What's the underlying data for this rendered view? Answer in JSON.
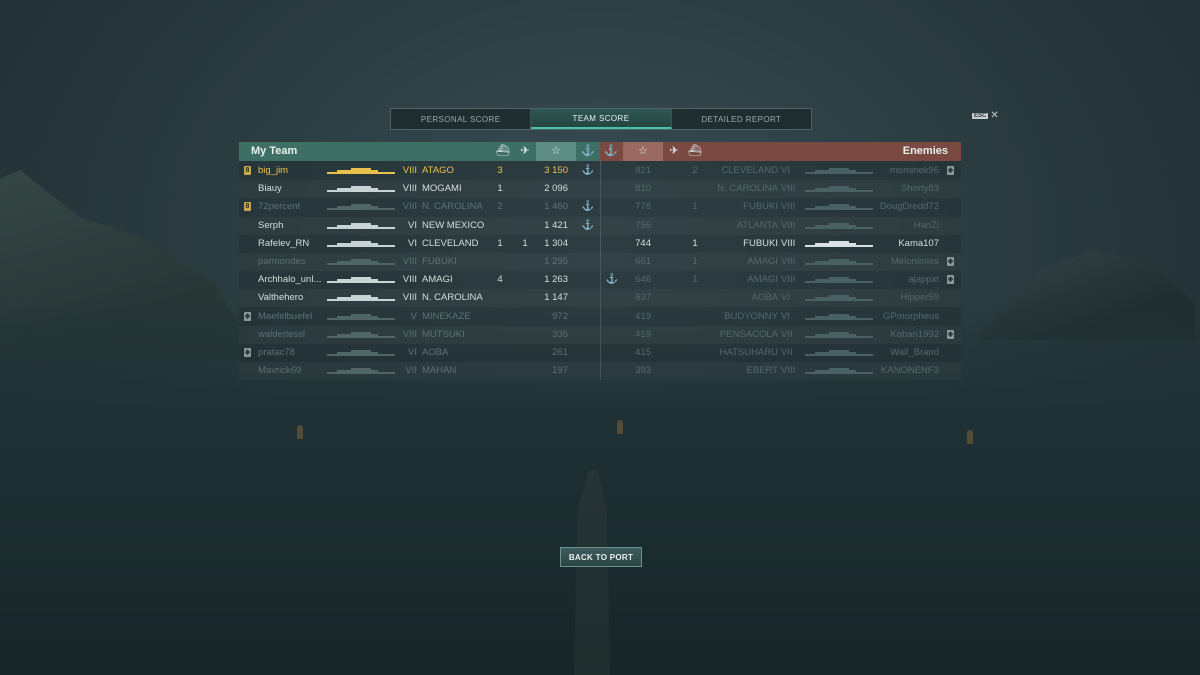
{
  "tabs": [
    {
      "label": "PERSONAL SCORE",
      "active": false
    },
    {
      "label": "TEAM SCORE",
      "active": true
    },
    {
      "label": "DETAILED REPORT",
      "active": false
    }
  ],
  "esc": {
    "key": "ESC",
    "close": "✕"
  },
  "team_header": {
    "title": "My Team",
    "icons": [
      "ship-icon",
      "planes-icon",
      "star-icon",
      "anchor-icon"
    ]
  },
  "enemy_header": {
    "title": "Enemies",
    "icons": [
      "anchor-icon",
      "star-icon",
      "planes-icon",
      "ship-icon"
    ]
  },
  "icon_glyphs": {
    "star": "☆",
    "anchor": "⚓",
    "planes": "✈",
    "ship": "⛴",
    "rank_badge": "8",
    "shield": "◈"
  },
  "colors": {
    "team_header": "#3d6f65",
    "enemy_header": "#7a4a42",
    "player_highlight": "#e8c14d",
    "active_tab_accent": "#47c2ad"
  },
  "my_team": [
    {
      "player": "big_jim",
      "tier": "VIII",
      "ship": "ATAGO",
      "kills": "3",
      "planes": "",
      "score": "3 150",
      "anchor": true,
      "badge": "rank",
      "state": "me"
    },
    {
      "player": "Biauy",
      "tier": "VIII",
      "ship": "MOGAMI",
      "kills": "1",
      "planes": "",
      "score": "2 096",
      "anchor": false,
      "badge": "",
      "state": "alive"
    },
    {
      "player": "72percent",
      "tier": "VIII",
      "ship": "N. CAROLINA",
      "kills": "2",
      "planes": "",
      "score": "1 460",
      "anchor": true,
      "badge": "rank",
      "state": "dead"
    },
    {
      "player": "Serph",
      "tier": "VI",
      "ship": "NEW MEXICO",
      "kills": "",
      "planes": "",
      "score": "1 421",
      "anchor": true,
      "badge": "",
      "state": "alive"
    },
    {
      "player": "Rafelev_RN",
      "tier": "VI",
      "ship": "CLEVELAND",
      "kills": "1",
      "planes": "1",
      "score": "1 304",
      "anchor": false,
      "badge": "",
      "state": "alive"
    },
    {
      "player": "parmondes",
      "tier": "VIII",
      "ship": "FUBUKI",
      "kills": "",
      "planes": "",
      "score": "1 295",
      "anchor": false,
      "badge": "",
      "state": "dead"
    },
    {
      "player": "Archhalo_unl...",
      "tier": "VIII",
      "ship": "AMAGI",
      "kills": "4",
      "planes": "",
      "score": "1 263",
      "anchor": false,
      "badge": "",
      "state": "alive"
    },
    {
      "player": "Valthehero",
      "tier": "VIII",
      "ship": "N. CAROLINA",
      "kills": "",
      "planes": "",
      "score": "1 147",
      "anchor": false,
      "badge": "",
      "state": "alive"
    },
    {
      "player": "Maefelbuefel",
      "tier": "V",
      "ship": "MINEKAZE",
      "kills": "",
      "planes": "",
      "score": "972",
      "anchor": false,
      "badge": "shield",
      "state": "dead"
    },
    {
      "player": "walderlessl",
      "tier": "VIII",
      "ship": "MUTSUKI",
      "kills": "",
      "planes": "",
      "score": "335",
      "anchor": false,
      "badge": "",
      "state": "dead"
    },
    {
      "player": "pratac78",
      "tier": "VI",
      "ship": "AOBA",
      "kills": "",
      "planes": "",
      "score": "261",
      "anchor": false,
      "badge": "shield",
      "state": "dead"
    },
    {
      "player": "Mavrick69",
      "tier": "VII",
      "ship": "MAHAN",
      "kills": "",
      "planes": "",
      "score": "197",
      "anchor": false,
      "badge": "",
      "state": "dead"
    }
  ],
  "enemies": [
    {
      "player": "mominek96",
      "tier": "VI",
      "ship": "CLEVELAND",
      "kills": "2",
      "planes": "",
      "score": "821",
      "anchor": false,
      "badge": "shield",
      "state": "dead"
    },
    {
      "player": "Shorty83",
      "tier": "VIII",
      "ship": "N. CAROLINA",
      "kills": "",
      "planes": "",
      "score": "810",
      "anchor": false,
      "badge": "",
      "state": "dead"
    },
    {
      "player": "DougDredd72",
      "tier": "VIII",
      "ship": "FUBUKI",
      "kills": "1",
      "planes": "",
      "score": "778",
      "anchor": false,
      "badge": "",
      "state": "dead"
    },
    {
      "player": "HanZi",
      "tier": "VIII",
      "ship": "ATLANTA",
      "kills": "",
      "planes": "",
      "score": "756",
      "anchor": false,
      "badge": "",
      "state": "dead"
    },
    {
      "player": "Kama107",
      "tier": "VIII",
      "ship": "FUBUKI",
      "kills": "1",
      "planes": "",
      "score": "744",
      "anchor": false,
      "badge": "",
      "state": "alive"
    },
    {
      "player": "Melonimies",
      "tier": "VIII",
      "ship": "AMAGI",
      "kills": "1",
      "planes": "",
      "score": "661",
      "anchor": false,
      "badge": "shield",
      "state": "dead"
    },
    {
      "player": "ajappxt",
      "tier": "VIII",
      "ship": "AMAGI",
      "kills": "1",
      "planes": "",
      "score": "646",
      "anchor": true,
      "badge": "shield",
      "state": "dead"
    },
    {
      "player": "Hipper59",
      "tier": "VI",
      "ship": "AOBA",
      "kills": "",
      "planes": "",
      "score": "637",
      "anchor": false,
      "badge": "",
      "state": "dead"
    },
    {
      "player": "GPmorpheus",
      "tier": "VI",
      "ship": "BUDYONNY",
      "kills": "",
      "planes": "",
      "score": "419",
      "anchor": false,
      "badge": "",
      "state": "dead"
    },
    {
      "player": "Koban1992",
      "tier": "VII",
      "ship": "PENSACOLA",
      "kills": "",
      "planes": "",
      "score": "419",
      "anchor": false,
      "badge": "shield",
      "state": "dead"
    },
    {
      "player": "Wall_Brand",
      "tier": "VII",
      "ship": "HATSUHARU",
      "kills": "",
      "planes": "",
      "score": "415",
      "anchor": false,
      "badge": "",
      "state": "dead"
    },
    {
      "player": "KANONENF3",
      "tier": "VIII",
      "ship": "EBERT",
      "kills": "",
      "planes": "",
      "score": "393",
      "anchor": false,
      "badge": "",
      "state": "dead"
    }
  ],
  "back_button": {
    "label": "BACK TO PORT"
  }
}
